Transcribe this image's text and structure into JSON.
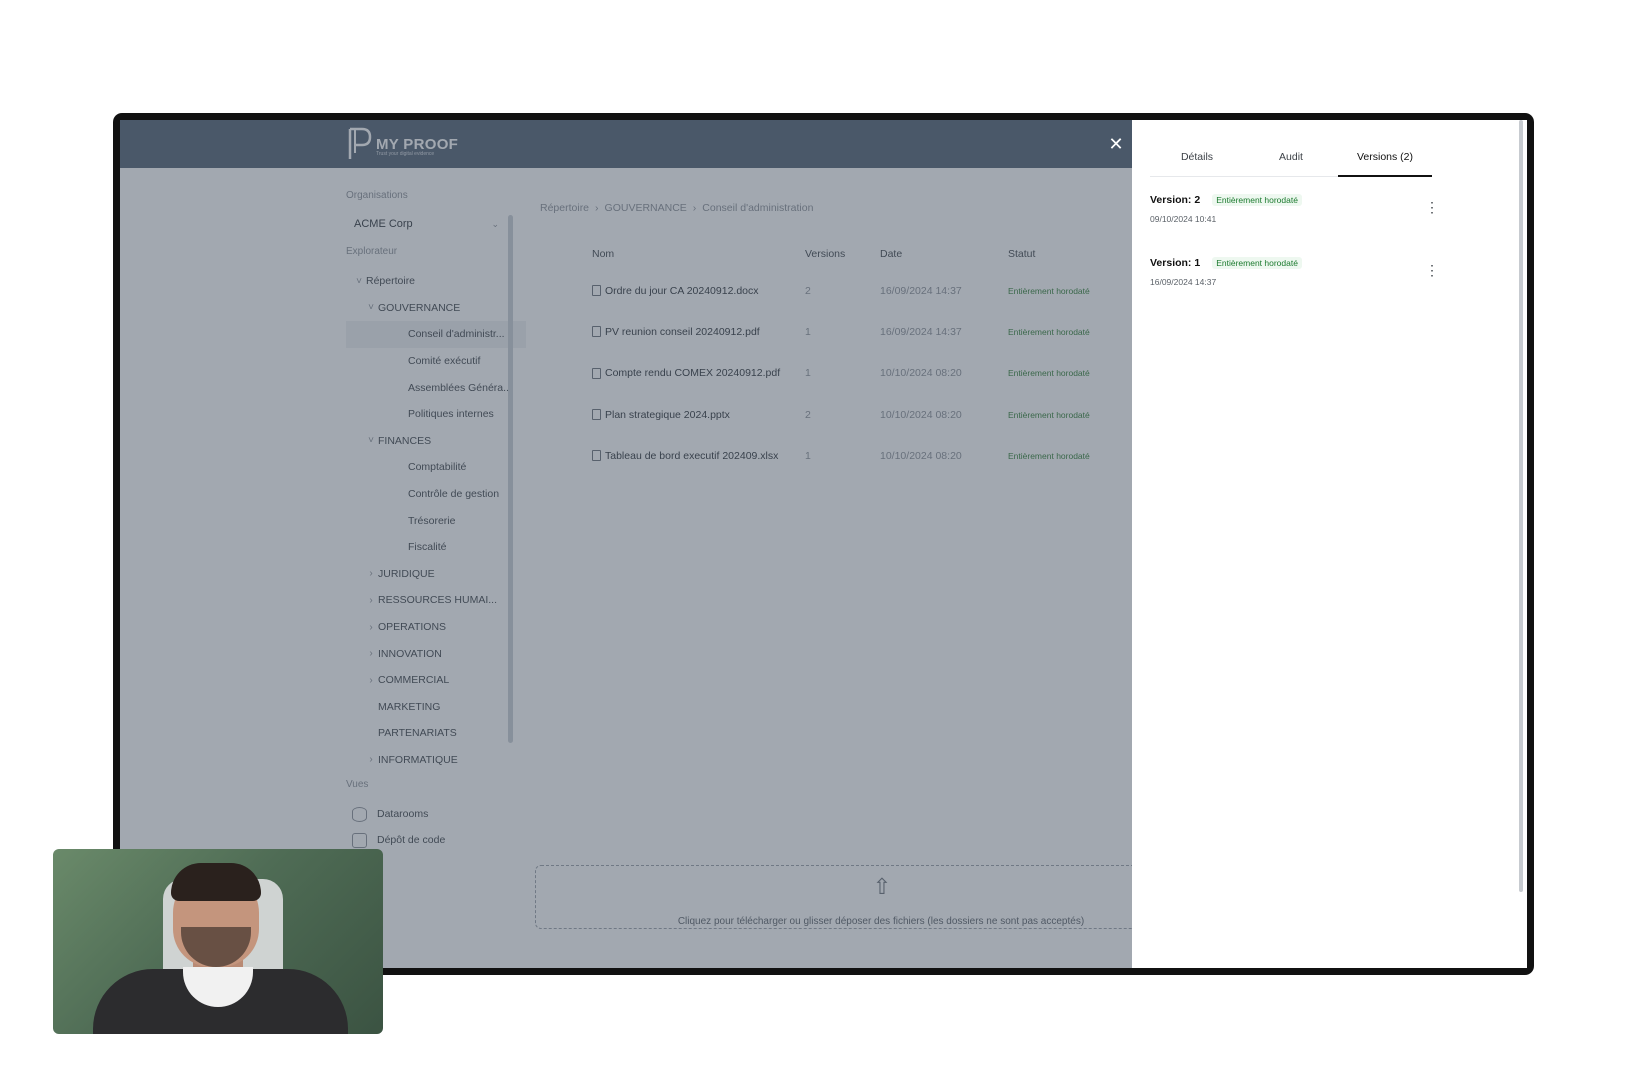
{
  "app": {
    "logo_text": "MY PROOF",
    "logo_tagline": "Trust your digital evidence",
    "close_icon": "close-icon"
  },
  "sidebar": {
    "organisations_title": "Organisations",
    "org_selected": "ACME Corp",
    "explorer_title": "Explorateur",
    "tree": [
      {
        "label": "Répertoire",
        "level": 0,
        "chevron": "v"
      },
      {
        "label": "GOUVERNANCE",
        "level": 1,
        "chevron": "v"
      },
      {
        "label": "Conseil d'administr...",
        "level": 2,
        "chevron": "",
        "active": true
      },
      {
        "label": "Comité exécutif",
        "level": 2,
        "chevron": ""
      },
      {
        "label": "Assemblées Généra...",
        "level": 2,
        "chevron": ""
      },
      {
        "label": "Politiques internes",
        "level": 2,
        "chevron": ""
      },
      {
        "label": "FINANCES",
        "level": 1,
        "chevron": "v"
      },
      {
        "label": "Comptabilité",
        "level": 2,
        "chevron": ""
      },
      {
        "label": "Contrôle de gestion",
        "level": 2,
        "chevron": ""
      },
      {
        "label": "Trésorerie",
        "level": 2,
        "chevron": ""
      },
      {
        "label": "Fiscalité",
        "level": 2,
        "chevron": ""
      },
      {
        "label": "JURIDIQUE",
        "level": 1,
        "chevron": ">"
      },
      {
        "label": "RESSOURCES HUMAI...",
        "level": 1,
        "chevron": ">"
      },
      {
        "label": "OPERATIONS",
        "level": 1,
        "chevron": ">"
      },
      {
        "label": "INNOVATION",
        "level": 1,
        "chevron": ">"
      },
      {
        "label": "COMMERCIAL",
        "level": 1,
        "chevron": ">"
      },
      {
        "label": "MARKETING",
        "level": 1,
        "chevron": ""
      },
      {
        "label": "PARTENARIATS",
        "level": 1,
        "chevron": ""
      },
      {
        "label": "INFORMATIQUE",
        "level": 1,
        "chevron": ">"
      }
    ],
    "views_title": "Vues",
    "views": [
      {
        "label": "Datarooms",
        "icon": "database-icon"
      },
      {
        "label": "Dépôt de code",
        "icon": "code-icon"
      }
    ]
  },
  "breadcrumb": [
    "Répertoire",
    "GOUVERNANCE",
    "Conseil d'administration"
  ],
  "table": {
    "headers": {
      "name": "Nom",
      "versions": "Versions",
      "date": "Date",
      "status": "Statut"
    },
    "rows": [
      {
        "name": "Ordre du jour CA 20240912.docx",
        "versions": "2",
        "date": "16/09/2024 14:37",
        "status": "Entièrement horodaté"
      },
      {
        "name": "PV reunion conseil 20240912.pdf",
        "versions": "1",
        "date": "16/09/2024 14:37",
        "status": "Entièrement horodaté"
      },
      {
        "name": "Compte rendu COMEX 20240912.pdf",
        "versions": "1",
        "date": "10/10/2024 08:20",
        "status": "Entièrement horodaté"
      },
      {
        "name": "Plan strategique 2024.pptx",
        "versions": "2",
        "date": "10/10/2024 08:20",
        "status": "Entièrement horodaté"
      },
      {
        "name": "Tableau de bord executif 202409.xlsx",
        "versions": "1",
        "date": "10/10/2024 08:20",
        "status": "Entièrement horodaté"
      }
    ]
  },
  "dropzone": {
    "text": "Cliquez pour télécharger ou glisser déposer des fichiers (les dossiers ne sont pas acceptés)"
  },
  "panel": {
    "tabs": [
      "Détails",
      "Audit",
      "Versions (2)"
    ],
    "active_tab": 2,
    "versions": [
      {
        "label": "Version: 2",
        "badge": "Entièrement horodaté",
        "date": "09/10/2024 10:41"
      },
      {
        "label": "Version: 1",
        "badge": "Entièrement horodaté",
        "date": "16/09/2024 14:37"
      }
    ]
  },
  "colors": {
    "topbar": "#4f5e70",
    "badge_text": "#1b7a2e",
    "badge_bg": "#eef8f0"
  }
}
